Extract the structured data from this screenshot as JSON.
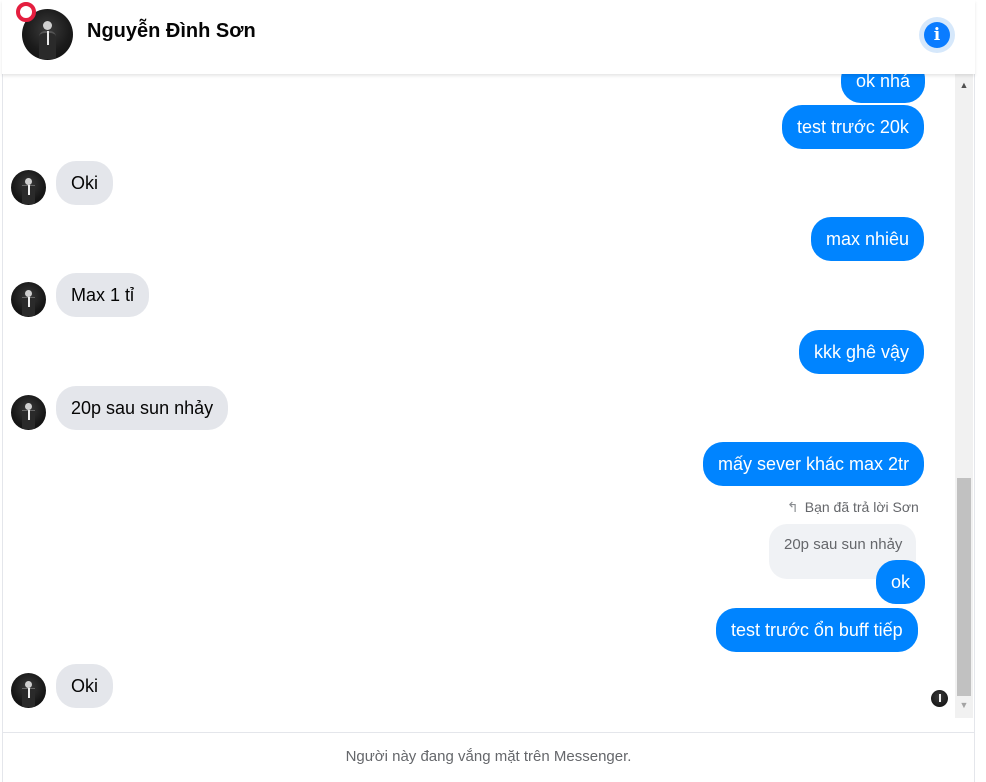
{
  "header": {
    "contact_name": "Nguyễn Đình Sơn",
    "avatar_icon": "profile-photo-avatar",
    "info_icon": "info-icon"
  },
  "messages": [
    {
      "side": "out",
      "text": "ok nhá"
    },
    {
      "side": "out",
      "text": "test trước 20k"
    },
    {
      "side": "in",
      "text": "Oki"
    },
    {
      "side": "out",
      "text": "max nhiêu"
    },
    {
      "side": "in",
      "text": "Max 1 tỉ"
    },
    {
      "side": "out",
      "text": "kkk ghê vậy"
    },
    {
      "side": "in",
      "text": "20p sau sun nhảy"
    },
    {
      "side": "out",
      "text": "mấy sever khác max 2tr"
    },
    {
      "reply": {
        "label": "Bạn đã trả lời Sơn",
        "quoted_text": "20p sau sun nhảy"
      }
    },
    {
      "side": "out",
      "text": "ok"
    },
    {
      "side": "out",
      "text": "test trước ổn buff tiếp"
    },
    {
      "side": "in",
      "text": "Oki"
    }
  ],
  "footer": {
    "status_text": "Người này đang vắng mặt trên Messenger."
  },
  "colors": {
    "outgoing_bubble": "#0084ff",
    "incoming_bubble": "#e4e6eb",
    "accent": "#0a7cff"
  }
}
